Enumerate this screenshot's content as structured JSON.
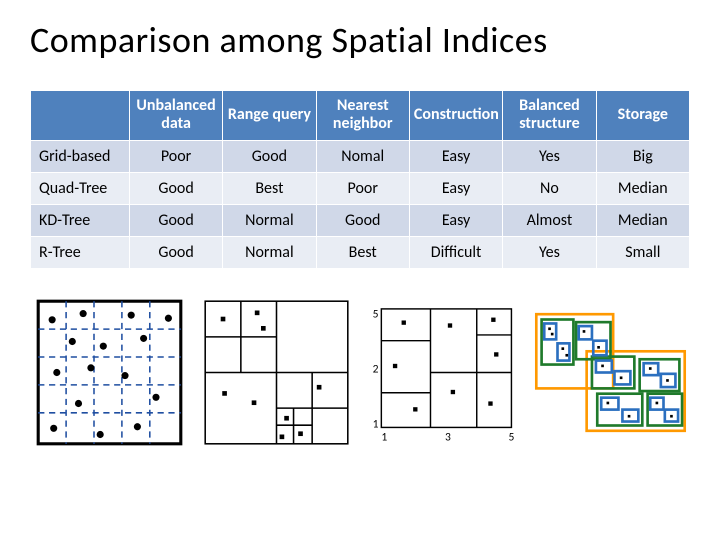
{
  "title": "Comparison among Spatial Indices",
  "table": {
    "columns": [
      "",
      "Unbalanced data",
      "Range query",
      "Nearest neighbor",
      "Construction",
      "Balanced structure",
      "Storage"
    ],
    "rows": [
      {
        "label": "Grid-based",
        "cells": [
          "Poor",
          "Good",
          "Nomal",
          "Easy",
          "Yes",
          "Big"
        ]
      },
      {
        "label": "Quad-Tree",
        "cells": [
          "Good",
          "Best",
          "Poor",
          "Easy",
          "No",
          "Median"
        ]
      },
      {
        "label": "KD-Tree",
        "cells": [
          "Good",
          "Normal",
          "Good",
          "Easy",
          "Almost",
          "Median"
        ]
      },
      {
        "label": "R-Tree",
        "cells": [
          "Good",
          "Normal",
          "Best",
          "Difficult",
          "Yes",
          "Small"
        ]
      }
    ]
  },
  "diagrams": {
    "grid": {
      "name": "Grid-based illustration"
    },
    "quad": {
      "name": "Quad-Tree illustration"
    },
    "kd": {
      "name": "KD-Tree illustration"
    },
    "rtree": {
      "name": "R-Tree illustration"
    }
  },
  "chart_data": {
    "type": "table",
    "title": "Comparison among Spatial Indices",
    "columns": [
      "Unbalanced data",
      "Range query",
      "Nearest neighbor",
      "Construction",
      "Balanced structure",
      "Storage"
    ],
    "rows": {
      "Grid-based": [
        "Poor",
        "Good",
        "Nomal",
        "Easy",
        "Yes",
        "Big"
      ],
      "Quad-Tree": [
        "Good",
        "Best",
        "Poor",
        "Easy",
        "No",
        "Median"
      ],
      "KD-Tree": [
        "Good",
        "Normal",
        "Good",
        "Easy",
        "Almost",
        "Median"
      ],
      "R-Tree": [
        "Good",
        "Normal",
        "Best",
        "Difficult",
        "Yes",
        "Small"
      ]
    }
  }
}
